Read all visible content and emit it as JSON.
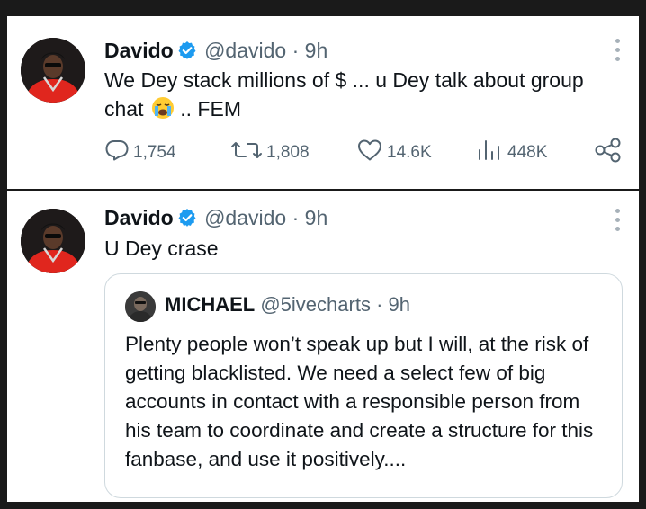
{
  "tweets": [
    {
      "display_name": "Davido",
      "handle": "@davido",
      "separator": "·",
      "time": "9h",
      "text_line1": "We Dey stack millions of $ ... u Dey talk about group",
      "text_line2_before_emoji": "chat",
      "emoji": "loudly-crying-face",
      "text_line2_after_emoji": ".. FEM",
      "replies": "1,754",
      "reposts": "1,808",
      "likes": "14.6K",
      "views": "448K"
    },
    {
      "display_name": "Davido",
      "handle": "@davido",
      "separator": "·",
      "time": "9h",
      "text": "U Dey crase",
      "quote": {
        "display_name": "MICHAEL",
        "handle": "@5ivecharts",
        "separator": "·",
        "time": "9h",
        "text": "Plenty people won’t speak up but I will, at the risk of getting blacklisted. We need a select few of big accounts in contact with a responsible person from his team to coordinate and create a structure for this fanbase, and use it positively...."
      }
    }
  ],
  "colors": {
    "text_primary": "#0f1419",
    "text_secondary": "#536471",
    "verified_blue": "#1d9bf0",
    "border": "#cfd9de",
    "background": "#ffffff"
  },
  "icons": [
    "verified-badge-icon",
    "more-options-icon",
    "reply-icon",
    "repost-icon",
    "like-icon",
    "views-icon",
    "share-icon"
  ]
}
